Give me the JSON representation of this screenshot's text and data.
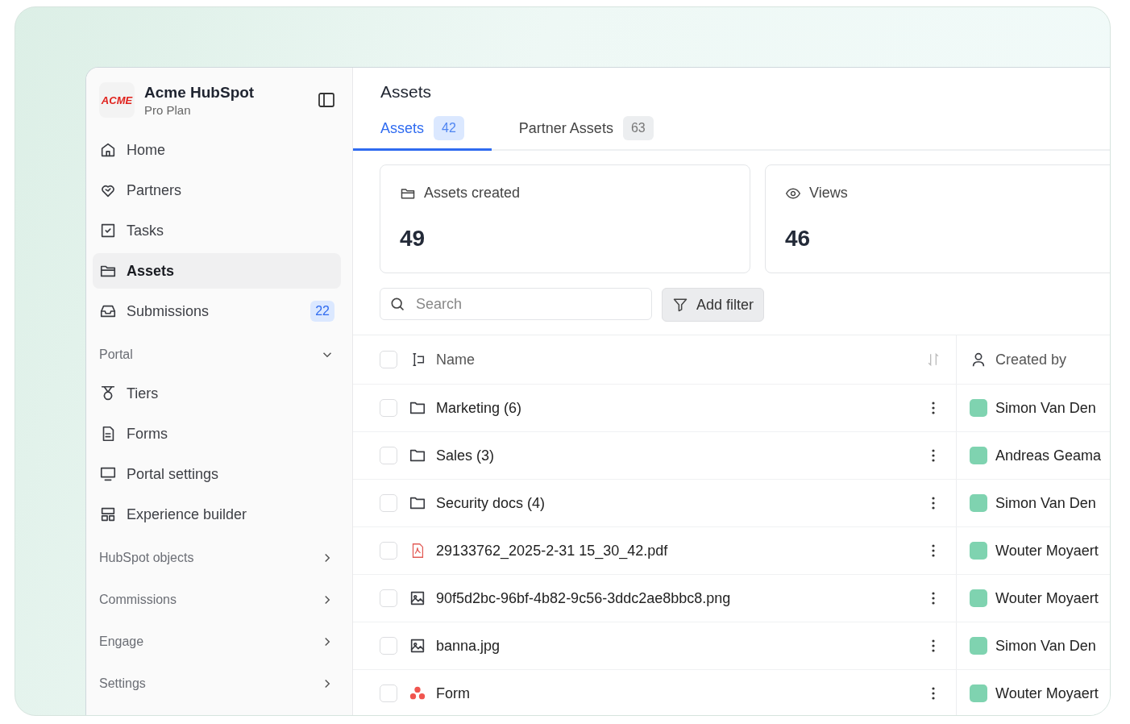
{
  "app": {
    "logo": "ACME",
    "name": "Acme HubSpot",
    "plan": "Pro Plan"
  },
  "sidebar": {
    "items": [
      {
        "kind": "home",
        "label": "Home",
        "selected": false
      },
      {
        "kind": "partners",
        "label": "Partners",
        "selected": false
      },
      {
        "kind": "tasks",
        "label": "Tasks",
        "selected": false
      },
      {
        "kind": "assets",
        "label": "Assets",
        "selected": true
      },
      {
        "kind": "submissions",
        "label": "Submissions",
        "selected": false,
        "badge": "22"
      },
      {
        "kind": "section",
        "label": "Portal",
        "expanded": true
      },
      {
        "kind": "tiers",
        "label": "Tiers",
        "selected": false
      },
      {
        "kind": "forms",
        "label": "Forms",
        "selected": false
      },
      {
        "kind": "portal",
        "label": "Portal settings",
        "selected": false
      },
      {
        "kind": "builder",
        "label": "Experience builder",
        "selected": false
      },
      {
        "kind": "section",
        "label": "HubSpot objects",
        "expanded": false
      },
      {
        "kind": "section",
        "label": "Commissions",
        "expanded": false
      },
      {
        "kind": "section",
        "label": "Engage",
        "expanded": false
      },
      {
        "kind": "section",
        "label": "Settings",
        "expanded": false
      }
    ]
  },
  "page": {
    "title": "Assets"
  },
  "tabs": [
    {
      "label": "Assets",
      "count": "42",
      "selected": true
    },
    {
      "label": "Partner Assets",
      "count": "63",
      "selected": false
    }
  ],
  "stats": [
    {
      "kind": "created",
      "label": "Assets created",
      "value": "49"
    },
    {
      "kind": "views",
      "label": "Views",
      "value": "46"
    }
  ],
  "search": {
    "placeholder": "Search"
  },
  "filter_button": "Add filter",
  "table": {
    "columns": [
      "Name",
      "Created by"
    ],
    "all_checked": false,
    "rows": [
      {
        "kind": "folder",
        "name": "Marketing (6)",
        "created_by": "Simon Van Den",
        "checked": false
      },
      {
        "kind": "folder",
        "name": "Sales  (3)",
        "created_by": "Andreas Geama",
        "checked": false
      },
      {
        "kind": "folder",
        "name": "Security docs (4)",
        "created_by": "Simon Van Den",
        "checked": false
      },
      {
        "kind": "pdf",
        "name": "29133762_2025-2-31 15_30_42.pdf",
        "created_by": "Wouter Moyaert",
        "checked": false
      },
      {
        "kind": "image",
        "name": "90f5d2bc-96bf-4b82-9c56-3ddc2ae8bbc8.png",
        "created_by": "Wouter Moyaert",
        "checked": false
      },
      {
        "kind": "image",
        "name": "banna.jpg",
        "created_by": "Simon Van Den",
        "checked": false
      },
      {
        "kind": "form",
        "name": "Form",
        "created_by": "Wouter Moyaert",
        "checked": false
      }
    ]
  }
}
